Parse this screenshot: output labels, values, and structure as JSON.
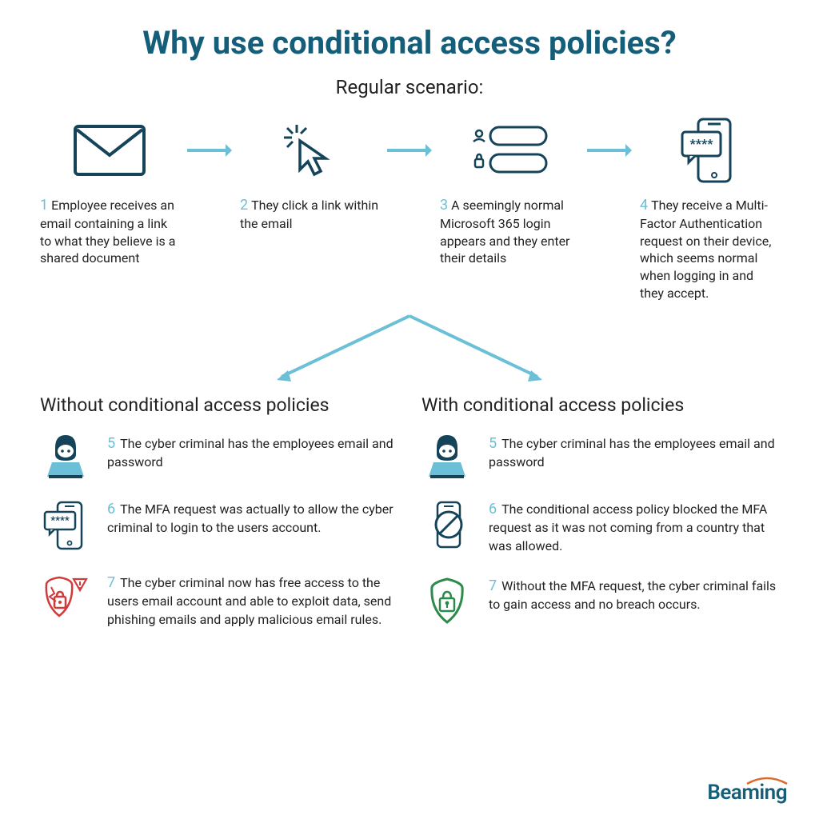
{
  "title": "Why use conditional access policies?",
  "subtitle": "Regular scenario:",
  "steps": [
    {
      "num": "1",
      "text": "Employee receives an email containing a link to what they believe is a shared document"
    },
    {
      "num": "2",
      "text": "They click a link within the email"
    },
    {
      "num": "3",
      "text": "A seemingly normal Microsoft 365 login appears and they enter their details"
    },
    {
      "num": "4",
      "text": "They receive a Multi-Factor Authentication request on their device, which seems normal when logging in and they accept."
    }
  ],
  "without": {
    "title": "Without conditional access policies",
    "items": [
      {
        "num": "5",
        "text": "The cyber criminal has the employees email and password"
      },
      {
        "num": "6",
        "text": "The MFA request was actually to allow the cyber criminal to login to the users account."
      },
      {
        "num": "7",
        "text": "The cyber criminal now has free access to the users email account and able to exploit data, send phishing emails and apply malicious email rules."
      }
    ]
  },
  "with": {
    "title": "With conditional access policies",
    "items": [
      {
        "num": "5",
        "text": "The cyber criminal has the employees email and password"
      },
      {
        "num": "6",
        "text": "The conditional access policy blocked the MFA request as it was not coming from a country that was allowed."
      },
      {
        "num": "7",
        "text": "Without the MFA request, the cyber criminal fails to gain access and no breach occurs."
      }
    ]
  },
  "brand": "Beaming",
  "colors": {
    "dark": "#15445a",
    "cyan": "#6bc0d8",
    "red": "#d23a3a",
    "green": "#2d8a4a"
  }
}
